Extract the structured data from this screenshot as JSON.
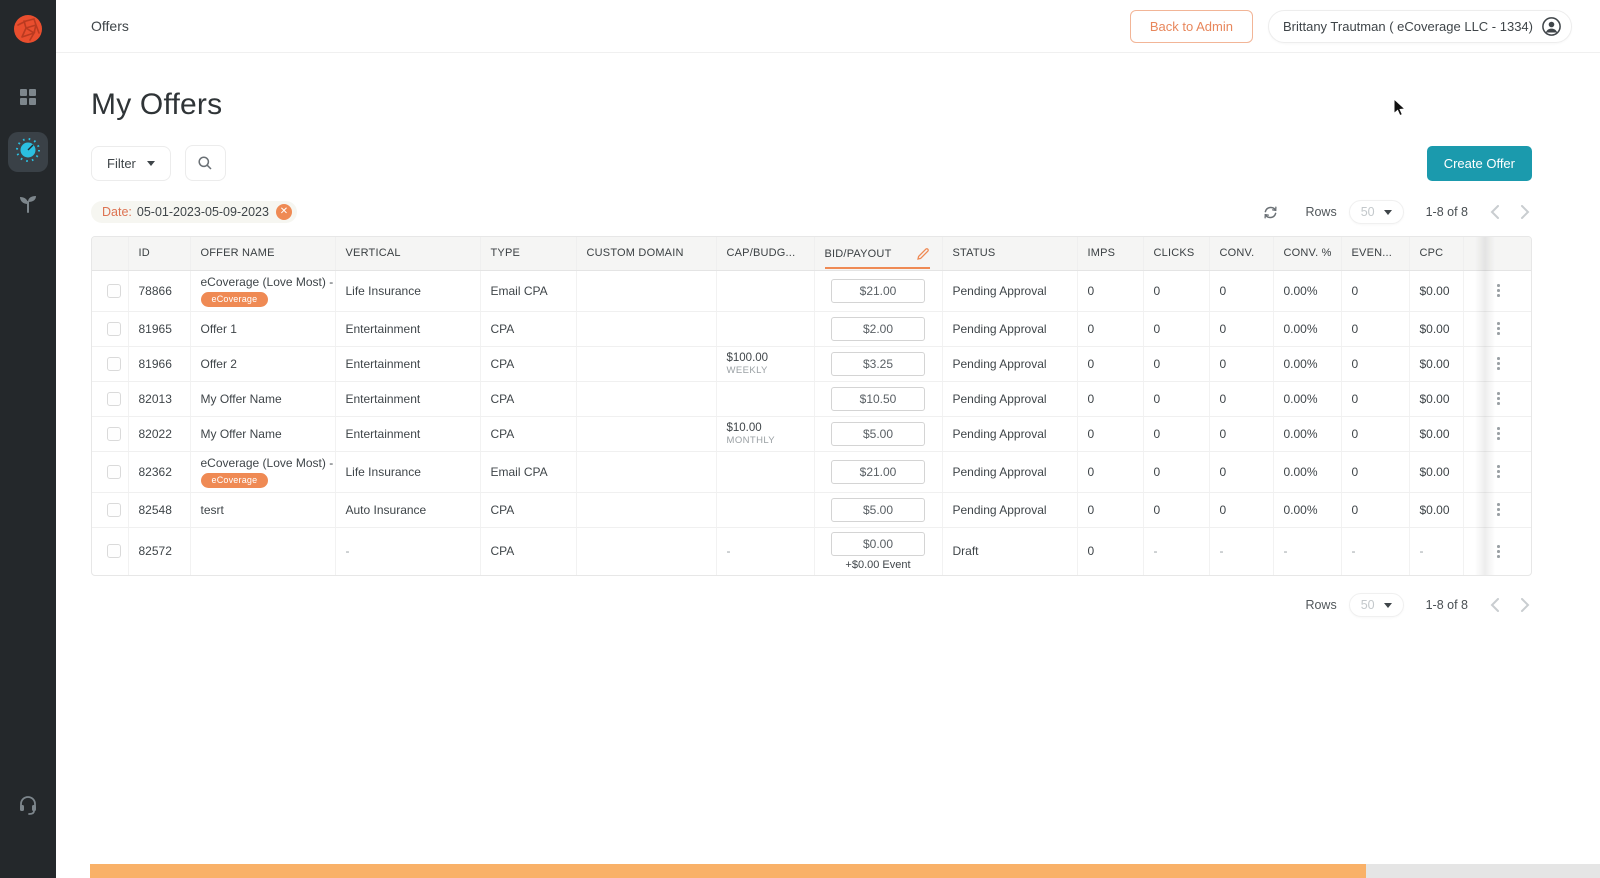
{
  "topbar": {
    "title": "Offers",
    "back_to_admin": "Back to Admin",
    "account": "Brittany Trautman ( eCoverage LLC - 1334)"
  },
  "page": {
    "title": "My Offers",
    "filter_button": "Filter",
    "create_offer_button": "Create Offer",
    "date_chip": {
      "label": "Date:",
      "value": "05-01-2023-05-09-2023",
      "close": "✕"
    }
  },
  "pagination": {
    "rows_label": "Rows",
    "page_size": "50",
    "range": "1-8 of 8"
  },
  "table": {
    "columns": [
      {
        "key": "id",
        "label": "ID"
      },
      {
        "key": "name",
        "label": "OFFER NAME"
      },
      {
        "key": "vertical",
        "label": "VERTICAL"
      },
      {
        "key": "type",
        "label": "TYPE"
      },
      {
        "key": "custom_domain",
        "label": "CUSTOM DOMAIN"
      },
      {
        "key": "cap",
        "label": "CAP/BUDG..."
      },
      {
        "key": "bid",
        "label": "BID/PAYOUT",
        "editable": true
      },
      {
        "key": "status",
        "label": "STATUS"
      },
      {
        "key": "imps",
        "label": "IMPS"
      },
      {
        "key": "clicks",
        "label": "CLICKS"
      },
      {
        "key": "conv",
        "label": "CONV."
      },
      {
        "key": "conv_pct",
        "label": "CONV. %"
      },
      {
        "key": "events",
        "label": "EVEN..."
      },
      {
        "key": "cpc",
        "label": "CPC"
      }
    ],
    "rows": [
      {
        "id": "78866",
        "name": "eCoverage (Love Most) - ...",
        "badge": "eCoverage",
        "vertical": "Life Insurance",
        "type": "Email CPA",
        "custom_domain": "",
        "cap": "",
        "cap_period": "",
        "bid": "$21.00",
        "bid_extra": "",
        "status": "Pending Approval",
        "imps": "0",
        "clicks": "0",
        "conv": "0",
        "conv_pct": "0.00%",
        "events": "0",
        "cpc": "$0.00"
      },
      {
        "id": "81965",
        "name": "Offer 1",
        "badge": "",
        "vertical": "Entertainment",
        "type": "CPA",
        "custom_domain": "",
        "cap": "",
        "cap_period": "",
        "bid": "$2.00",
        "bid_extra": "",
        "status": "Pending Approval",
        "imps": "0",
        "clicks": "0",
        "conv": "0",
        "conv_pct": "0.00%",
        "events": "0",
        "cpc": "$0.00"
      },
      {
        "id": "81966",
        "name": "Offer 2",
        "badge": "",
        "vertical": "Entertainment",
        "type": "CPA",
        "custom_domain": "",
        "cap": "$100.00",
        "cap_period": "WEEKLY",
        "bid": "$3.25",
        "bid_extra": "",
        "status": "Pending Approval",
        "imps": "0",
        "clicks": "0",
        "conv": "0",
        "conv_pct": "0.00%",
        "events": "0",
        "cpc": "$0.00"
      },
      {
        "id": "82013",
        "name": "My Offer Name",
        "badge": "",
        "vertical": "Entertainment",
        "type": "CPA",
        "custom_domain": "",
        "cap": "",
        "cap_period": "",
        "bid": "$10.50",
        "bid_extra": "",
        "status": "Pending Approval",
        "imps": "0",
        "clicks": "0",
        "conv": "0",
        "conv_pct": "0.00%",
        "events": "0",
        "cpc": "$0.00"
      },
      {
        "id": "82022",
        "name": "My Offer Name",
        "badge": "",
        "vertical": "Entertainment",
        "type": "CPA",
        "custom_domain": "",
        "cap": "$10.00",
        "cap_period": "MONTHLY",
        "bid": "$5.00",
        "bid_extra": "",
        "status": "Pending Approval",
        "imps": "0",
        "clicks": "0",
        "conv": "0",
        "conv_pct": "0.00%",
        "events": "0",
        "cpc": "$0.00"
      },
      {
        "id": "82362",
        "name": "eCoverage (Love Most) - ...",
        "badge": "eCoverage",
        "vertical": "Life Insurance",
        "type": "Email CPA",
        "custom_domain": "",
        "cap": "",
        "cap_period": "",
        "bid": "$21.00",
        "bid_extra": "",
        "status": "Pending Approval",
        "imps": "0",
        "clicks": "0",
        "conv": "0",
        "conv_pct": "0.00%",
        "events": "0",
        "cpc": "$0.00"
      },
      {
        "id": "82548",
        "name": "tesrt",
        "badge": "",
        "vertical": "Auto Insurance",
        "type": "CPA",
        "custom_domain": "",
        "cap": "",
        "cap_period": "",
        "bid": "$5.00",
        "bid_extra": "",
        "status": "Pending Approval",
        "imps": "0",
        "clicks": "0",
        "conv": "0",
        "conv_pct": "0.00%",
        "events": "0",
        "cpc": "$0.00"
      },
      {
        "id": "82572",
        "name": "",
        "badge": "",
        "vertical": "-",
        "type": "CPA",
        "custom_domain": "",
        "cap": "-",
        "cap_period": "",
        "bid": "$0.00",
        "bid_extra": "+$0.00 Event",
        "status": "Draft",
        "imps": "0",
        "clicks": "-",
        "conv": "-",
        "conv_pct": "-",
        "events": "-",
        "cpc": "-"
      }
    ]
  },
  "icons": {
    "sidebar": [
      "logo",
      "dashboard-grid-icon",
      "offers-gauge-icon",
      "growth-plant-icon",
      "support-headset-icon"
    ],
    "misc": [
      "search-icon",
      "caret-down-icon",
      "refresh-icon",
      "pencil-edit-icon",
      "kebab-menu-icon",
      "user-avatar-icon",
      "close-icon",
      "chevron-left-icon",
      "chevron-right-icon"
    ]
  },
  "colors": {
    "accent_orange": "#EF8A54",
    "teal": "#1B9AAD",
    "sidebar_bg": "#24282B",
    "cyan": "#2BBFE0",
    "bottom_bar_orange": "#F9B168",
    "logo_red": "#E94E2E"
  }
}
